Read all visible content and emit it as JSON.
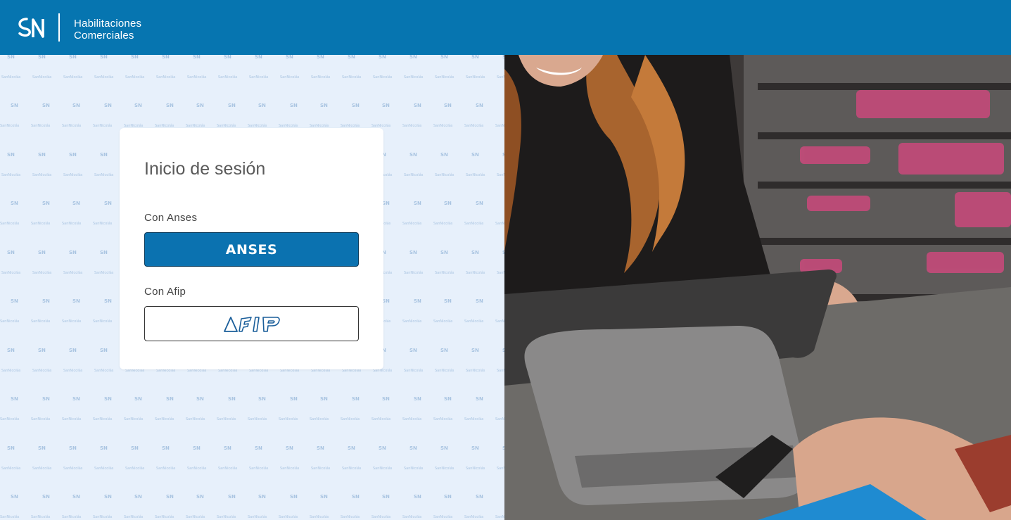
{
  "header": {
    "logo_alt": "SN logo",
    "title_line1": "Habilitaciones",
    "title_line2": "Comerciales"
  },
  "login": {
    "title": "Inicio de sesión",
    "anses_label": "Con Anses",
    "anses_button_text": "ANSES",
    "afip_label": "Con Afip",
    "afip_button_text": "AFIP"
  },
  "colors": {
    "header_bg": "#0675b0",
    "left_bg": "#e7f0fb",
    "anses_button_bg": "#0b72b0",
    "card_bg": "#ffffff"
  },
  "icons": {
    "logo": "sn-logo-icon",
    "afip": "afip-logo-icon",
    "pattern_watermark": "San Nicolás"
  }
}
